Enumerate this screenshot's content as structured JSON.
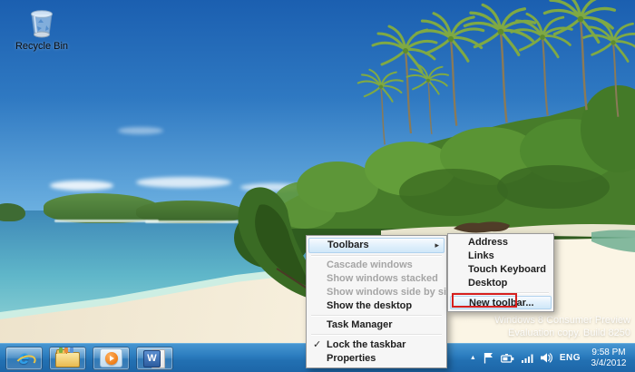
{
  "desktop": {
    "recycle_bin": {
      "label": "Recycle Bin"
    },
    "watermark": {
      "line1": "Windows 8 Consumer Preview",
      "line2": "Evaluation copy. Build 8250"
    }
  },
  "context_menu": {
    "items": [
      {
        "label": "Toolbars",
        "disabled": false,
        "has_submenu": true,
        "highlighted": true
      },
      {
        "label": "Cascade windows",
        "disabled": true
      },
      {
        "label": "Show windows stacked",
        "disabled": true
      },
      {
        "label": "Show windows side by side",
        "disabled": true
      },
      {
        "label": "Show the desktop",
        "disabled": false
      },
      {
        "label": "Task Manager",
        "disabled": false
      },
      {
        "label": "Lock the taskbar",
        "disabled": false,
        "checked": true
      },
      {
        "label": "Properties",
        "disabled": false
      }
    ]
  },
  "toolbars_submenu": {
    "items": [
      {
        "label": "Address"
      },
      {
        "label": "Links"
      },
      {
        "label": "Touch Keyboard"
      },
      {
        "label": "Desktop"
      },
      {
        "label": "New toolbar...",
        "highlighted": true,
        "annotated_red_box": true
      }
    ]
  },
  "taskbar": {
    "buttons": [
      {
        "name": "internet-explorer"
      },
      {
        "name": "file-explorer"
      },
      {
        "name": "windows-media-player"
      },
      {
        "name": "microsoft-word"
      }
    ],
    "tray": {
      "language": "ENG",
      "time": "9:58 PM",
      "date": "3/4/2012"
    }
  },
  "icons": {
    "submenu_arrow": "▸",
    "checkmark": "✓",
    "tray_expand": "▲",
    "ie_glyph": "e",
    "word_glyph": "W"
  },
  "colors": {
    "taskbar_top": "#4796d1",
    "taskbar_bottom": "#1d66a8",
    "menu_bg": "#f6f6f6",
    "menu_border": "#9a9a9a",
    "menu_text": "#1e1e1e",
    "menu_disabled": "#a5a5a5",
    "highlight_border": "#b0d2ee",
    "annotation_red": "#d6201f",
    "sky_top": "#1b5fb0",
    "sky_bottom": "#6fb3e2",
    "sea_deep": "#3e88b8",
    "sea_shallow": "#8fd2d4",
    "shore_foam": "#cdeee3",
    "sand": "#ece1c9",
    "sand_bright": "#fbf5e5",
    "green_dark": "#2f5c1f",
    "green_mid": "#477c2a",
    "green_light": "#5d9638",
    "trunk": "#8a7a58"
  }
}
